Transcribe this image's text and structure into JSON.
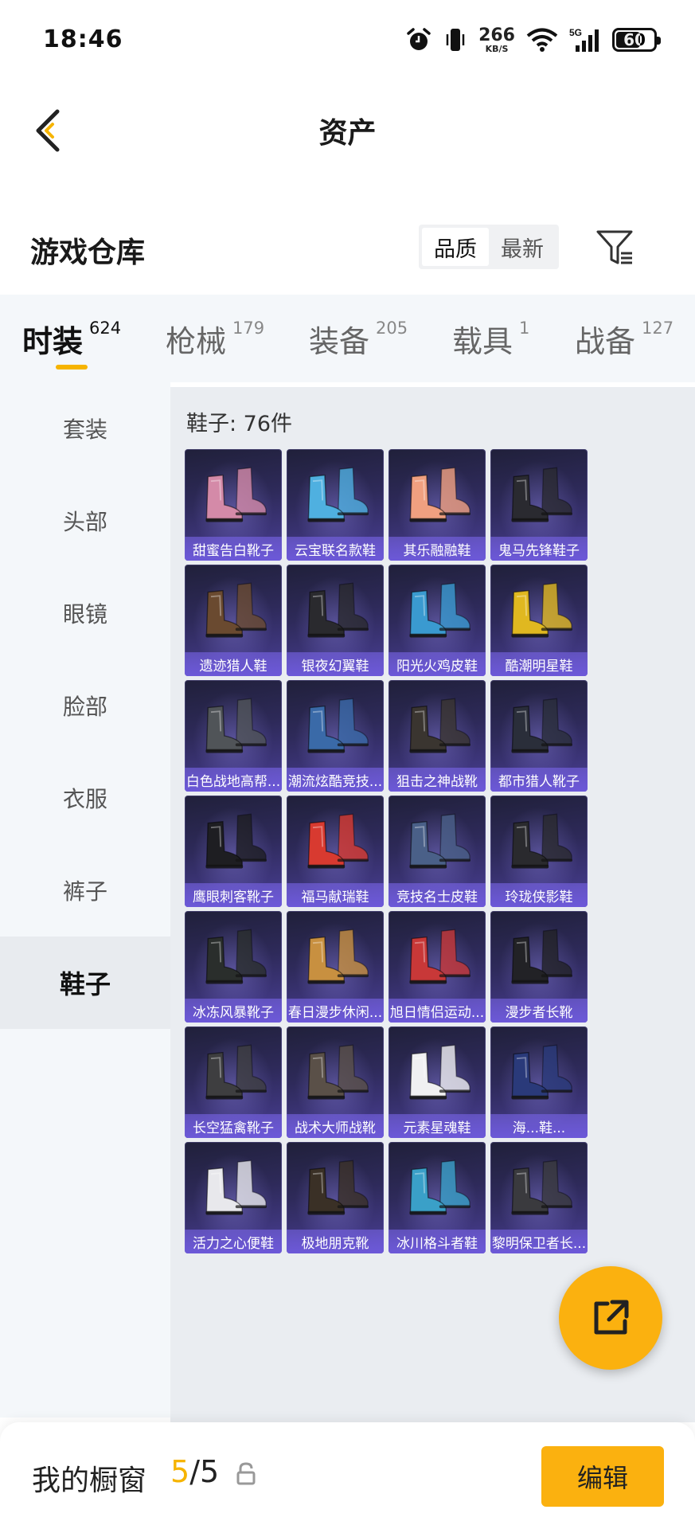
{
  "status_bar": {
    "time": "18:46",
    "net_speed": "266",
    "net_unit": "KB/S",
    "network": "5G",
    "battery": "60"
  },
  "header": {
    "title": "资产"
  },
  "section": {
    "title": "游戏仓库",
    "sort_options": [
      "品质",
      "最新"
    ],
    "sort_selected": "品质"
  },
  "tabs": [
    {
      "label": "时装",
      "count": "624",
      "active": true
    },
    {
      "label": "枪械",
      "count": "179",
      "active": false
    },
    {
      "label": "装备",
      "count": "205",
      "active": false
    },
    {
      "label": "载具",
      "count": "1",
      "active": false
    },
    {
      "label": "战备",
      "count": "127",
      "active": false
    }
  ],
  "sidebar": {
    "items": [
      {
        "label": "套装",
        "active": false
      },
      {
        "label": "头部",
        "active": false
      },
      {
        "label": "眼镜",
        "active": false
      },
      {
        "label": "脸部",
        "active": false
      },
      {
        "label": "衣服",
        "active": false
      },
      {
        "label": "裤子",
        "active": false
      },
      {
        "label": "鞋子",
        "active": true
      }
    ]
  },
  "content": {
    "count_label": "鞋子: 76件",
    "items": [
      {
        "name": "甜蜜告白靴子",
        "color": "#d48aa8"
      },
      {
        "name": "云宝联名款鞋",
        "color": "#4fb0e0"
      },
      {
        "name": "其乐融融鞋",
        "color": "#f0a080"
      },
      {
        "name": "鬼马先锋鞋子",
        "color": "#2a2a30"
      },
      {
        "name": "遗迹猎人鞋",
        "color": "#6a4a30"
      },
      {
        "name": "银夜幻翼鞋",
        "color": "#2a2a2e"
      },
      {
        "name": "阳光火鸡皮鞋",
        "color": "#3a9ad0"
      },
      {
        "name": "酷潮明星鞋",
        "color": "#e0b820"
      },
      {
        "name": "白色战地高帮...",
        "color": "#505458"
      },
      {
        "name": "潮流炫酷竞技...",
        "color": "#3a6aa8"
      },
      {
        "name": "狙击之神战靴",
        "color": "#3a3530"
      },
      {
        "name": "都市猎人靴子",
        "color": "#2a2e3a"
      },
      {
        "name": "鹰眼刺客靴子",
        "color": "#1e1e22"
      },
      {
        "name": "福马献瑞鞋",
        "color": "#d83a30"
      },
      {
        "name": "竞技名士皮鞋",
        "color": "#4a6088"
      },
      {
        "name": "玲珑侠影鞋",
        "color": "#2a2a2e"
      },
      {
        "name": "冰冻风暴靴子",
        "color": "#2a2e2c"
      },
      {
        "name": "春日漫步休闲...",
        "color": "#c89040"
      },
      {
        "name": "旭日情侣运动...",
        "color": "#c83838"
      },
      {
        "name": "漫步者长靴",
        "color": "#222226"
      },
      {
        "name": "长空猛禽靴子",
        "color": "#3e3e40"
      },
      {
        "name": "战术大师战靴",
        "color": "#5a5048"
      },
      {
        "name": "元素星魂鞋",
        "color": "#f0f0f2"
      },
      {
        "name": "海...鞋...",
        "color": "#2a3a7a"
      },
      {
        "name": "活力之心便鞋",
        "color": "#e8e8ec"
      },
      {
        "name": "极地朋克靴",
        "color": "#3a3026"
      },
      {
        "name": "冰川格斗者鞋",
        "color": "#3aa0c8"
      },
      {
        "name": "黎明保卫者长...",
        "color": "#3a3a3e"
      }
    ]
  },
  "bottom_bar": {
    "label": "我的橱窗",
    "count_current": "5",
    "count_sep": "/",
    "count_total": "5",
    "edit_label": "编辑"
  },
  "colors": {
    "accent": "#fbb10f",
    "card_bottom": "#6e5adc"
  }
}
